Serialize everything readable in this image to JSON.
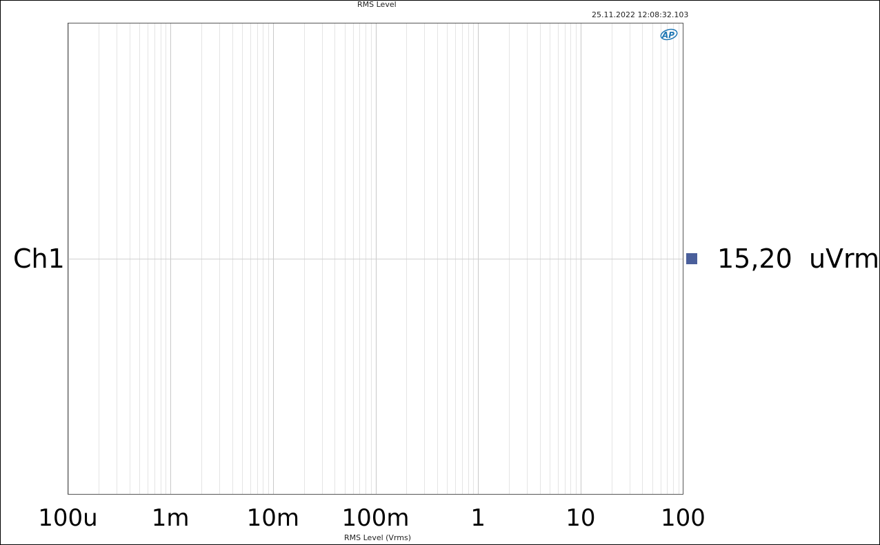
{
  "chart_data": {
    "type": "meter",
    "title": "RMS Level",
    "timestamp": "25.11.2022 12:08:32.103",
    "xlabel": "RMS Level (Vrms)",
    "x_scale": "log",
    "xlim": [
      0.0001,
      100
    ],
    "x_tick_labels": [
      "100u",
      "1m",
      "10m",
      "100m",
      "1",
      "10",
      "100"
    ],
    "x_tick_values": [
      0.0001,
      0.001,
      0.01,
      0.1,
      1,
      10,
      100
    ],
    "grid": true,
    "series": [
      {
        "name": "Ch1",
        "value": 1.52e-05,
        "readout": "15,20  uVrms",
        "color": "#4a5f9b"
      }
    ]
  },
  "logo": {
    "text": "AP",
    "color": "#1f77b4"
  }
}
